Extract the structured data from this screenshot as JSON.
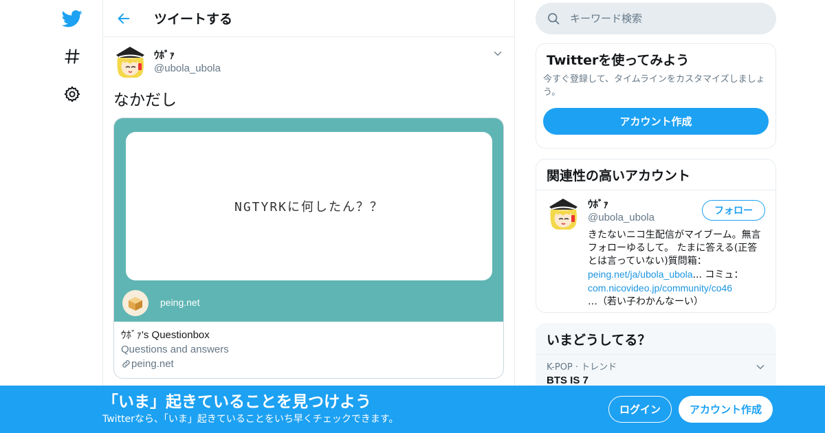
{
  "nav": {
    "items": [
      {
        "icon": "twitter-bird-icon"
      },
      {
        "icon": "hashtag-icon"
      },
      {
        "icon": "gear-icon"
      }
    ]
  },
  "header": {
    "title": "ツイートする",
    "back_icon": "back-arrow-icon"
  },
  "tweet": {
    "display_name": "ｳﾎﾞｧ",
    "handle": "@ubola_ubola",
    "text": "なかだし",
    "card": {
      "image_text": "NGTYRKに何したん？？",
      "site_label": "peing.net",
      "title": "ｳﾎﾞｧ's Questionbox",
      "description": "Questions and answers",
      "link": "peing.net",
      "image_bg": "#5fb5b4"
    }
  },
  "search": {
    "placeholder": "キーワード検索"
  },
  "signup_box": {
    "title": "Twitterを使ってみよう",
    "text": "今すぐ登録して、タイムラインをカスタマイズしましょう。",
    "button": "アカウント作成"
  },
  "related": {
    "title": "関連性の高いアカウント",
    "account": {
      "display_name": "ｳﾎﾞｧ",
      "handle": "@ubola_ubola",
      "follow_label": "フォロー",
      "bio_1": "きたないニコ生配信がマイブーム。無言フォローゆるして。 たまに答える(正答とは言っていない)質問箱：",
      "bio_link_1": "peing.net/ja/ubola_ubola",
      "bio_2": "... コミュ：",
      "bio_link_2": "com.nicovideo.jp/community/co46",
      "bio_3": "…（若い子わかんなーい）"
    }
  },
  "trends": {
    "title": "いまどうしてる？",
    "items": [
      {
        "meta": "K-POP · トレンド",
        "name": "BTS IS 7"
      }
    ]
  },
  "banner": {
    "title": "「いま」起きていることを見つけよう",
    "subtitle": "Twitterなら、「いま」起きていることをいち早くチェックできます。",
    "login": "ログイン",
    "signup": "アカウント作成"
  },
  "colors": {
    "accent": "#1da1f2",
    "card_teal": "#5fb5b4",
    "muted_text": "#657786",
    "border": "#e6ecf0"
  }
}
